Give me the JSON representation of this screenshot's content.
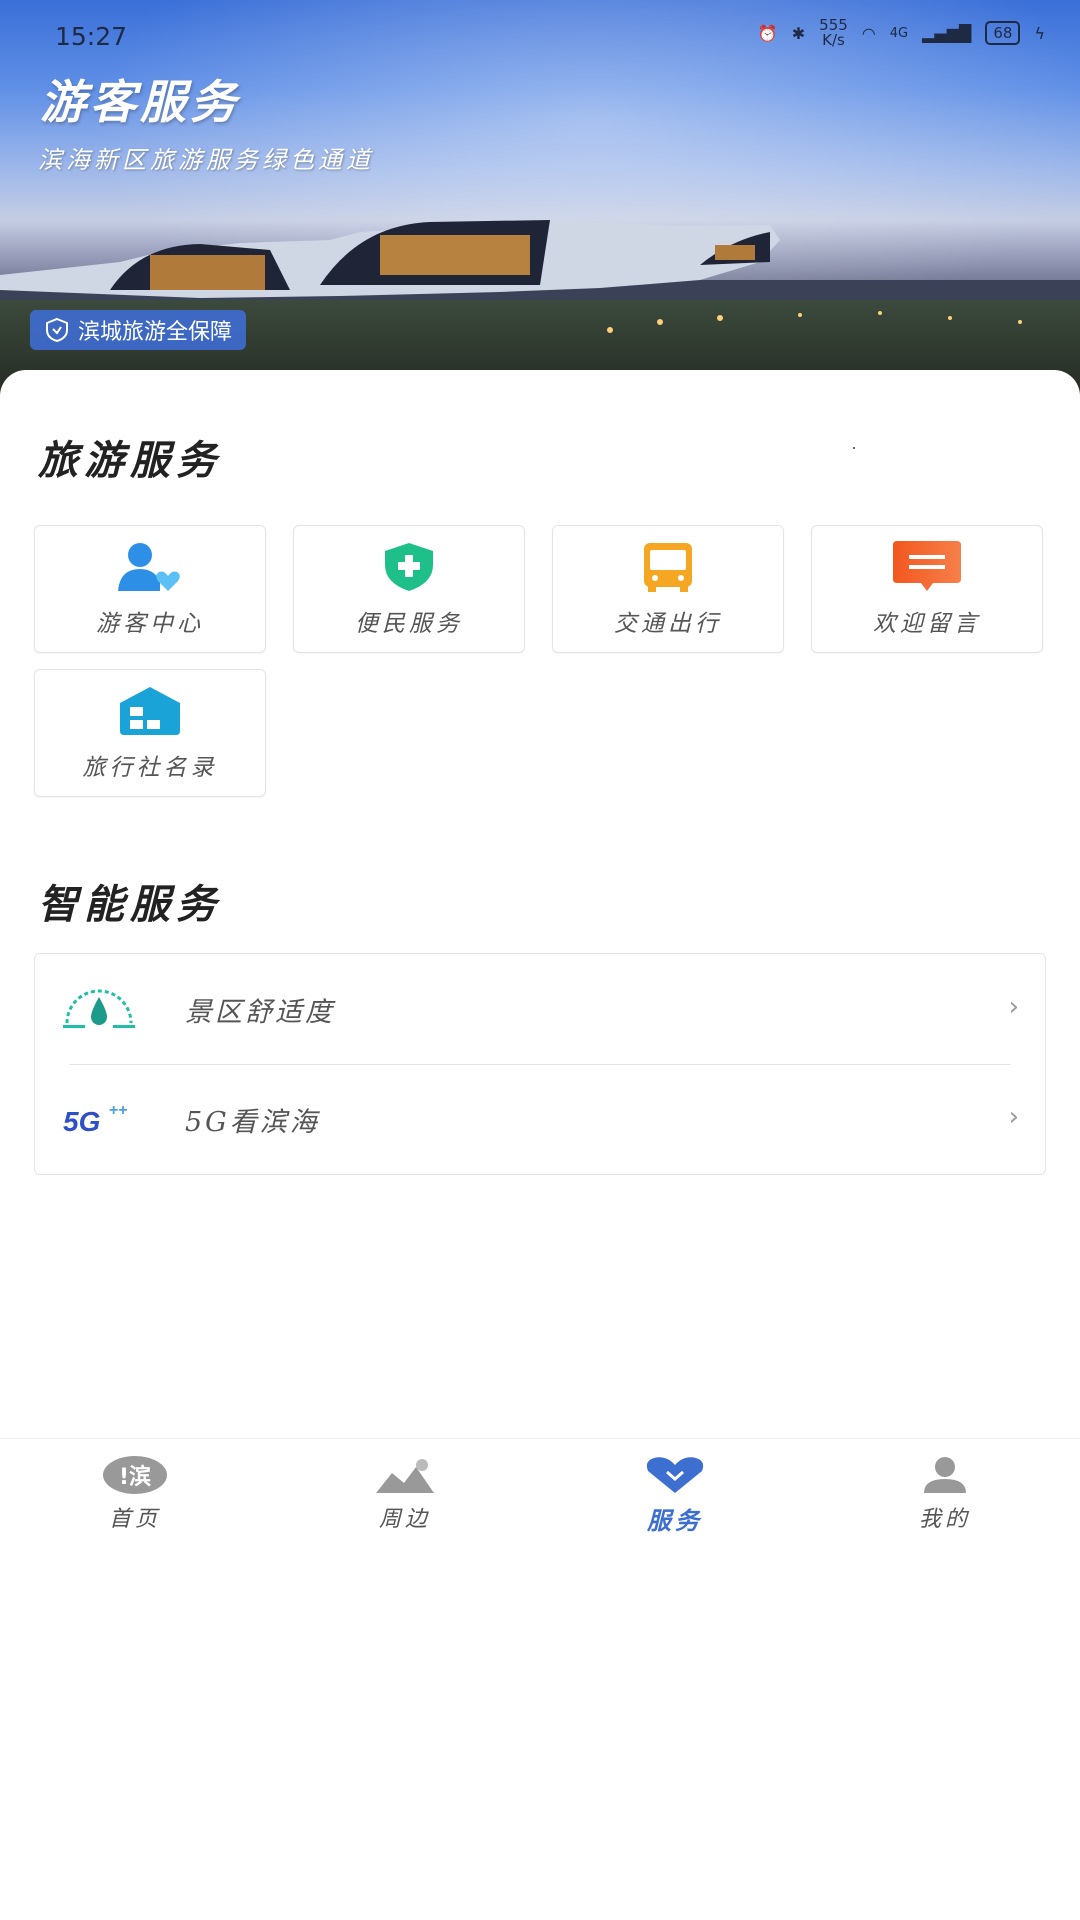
{
  "status_bar": {
    "time": "15:27",
    "net_speed_value": "555",
    "net_speed_unit": "K/s",
    "network": "4G",
    "battery": "68",
    "icons": [
      "alarm-icon",
      "bluetooth-icon",
      "wifi-icon",
      "signal-icon",
      "battery-icon",
      "charging-icon"
    ]
  },
  "hero": {
    "title": "游客服务",
    "subtitle": "滨海新区旅游服务绿色通道",
    "badge": "滨城旅游全保障"
  },
  "travel_services": {
    "title": "旅游服务",
    "items": [
      {
        "label": "游客中心",
        "icon": "visitor-center-icon",
        "color": "#2d8fe6"
      },
      {
        "label": "便民服务",
        "icon": "medical-shield-icon",
        "color": "#1fbf8a"
      },
      {
        "label": "交通出行",
        "icon": "bus-icon",
        "color": "#f5a623"
      },
      {
        "label": "欢迎留言",
        "icon": "message-icon",
        "color": "#f25a2a"
      },
      {
        "label": "旅行社名录",
        "icon": "agency-directory-icon",
        "color": "#1aa3d6"
      }
    ]
  },
  "smart_services": {
    "title": "智能服务",
    "items": [
      {
        "label": "景区舒适度",
        "icon": "comfort-gauge-icon"
      },
      {
        "label": "5G看滨海",
        "icon": "5g-icon"
      }
    ]
  },
  "tab_bar": {
    "active": "服务",
    "accent": "#3d6fd0",
    "tabs": [
      {
        "label": "首页",
        "icon": "home-icon"
      },
      {
        "label": "周边",
        "icon": "landscape-icon"
      },
      {
        "label": "服务",
        "icon": "heart-icon"
      },
      {
        "label": "我的",
        "icon": "profile-icon"
      }
    ]
  }
}
